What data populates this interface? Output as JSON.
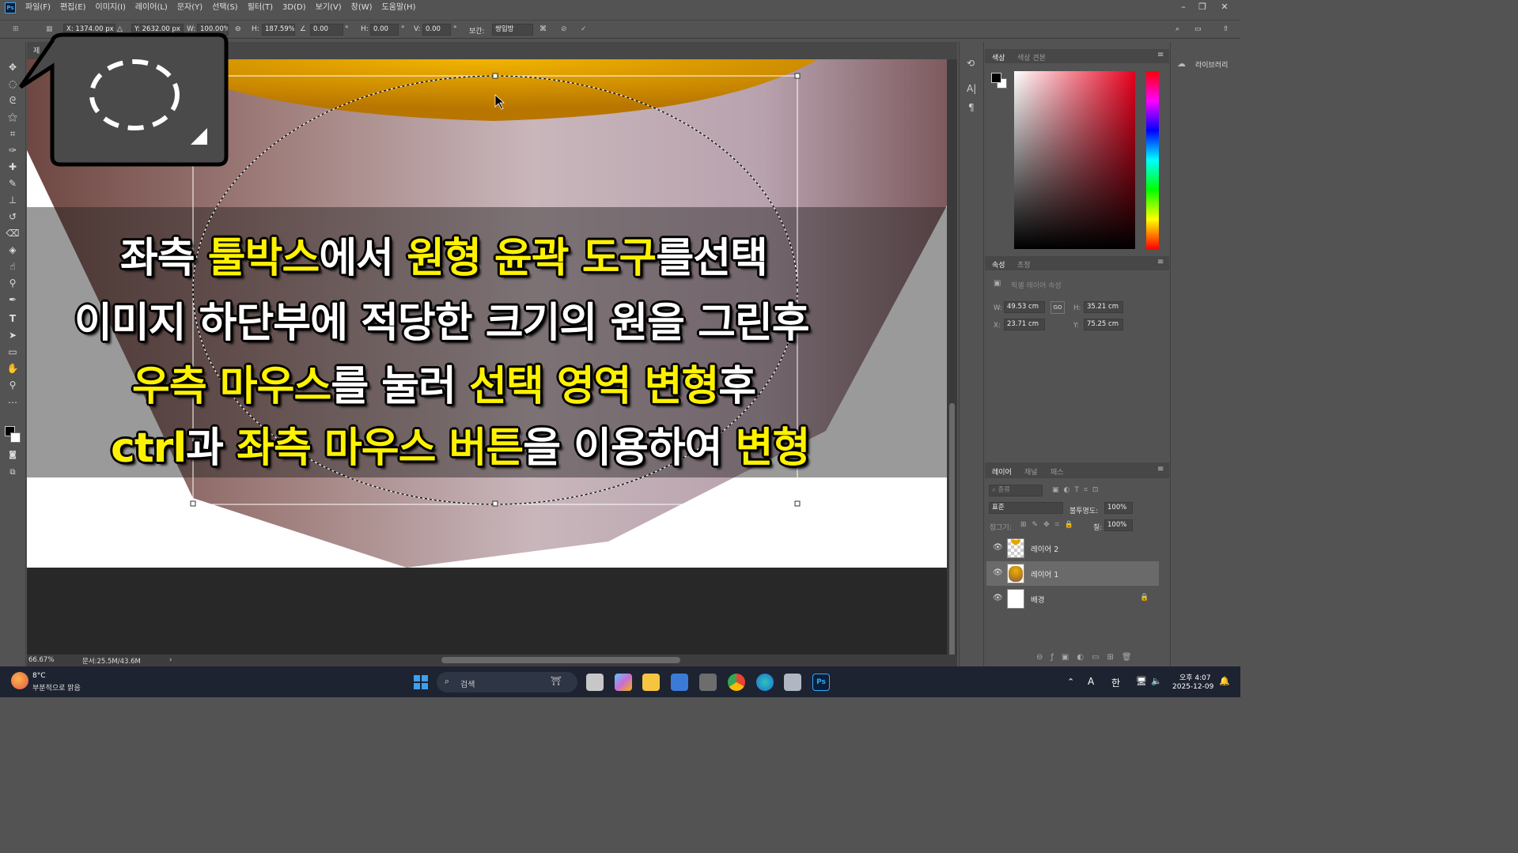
{
  "app": {
    "logo": "Ps",
    "menu": [
      "파일(F)",
      "편집(E)",
      "이미지(I)",
      "레이어(L)",
      "문자(Y)",
      "선택(S)",
      "필터(T)",
      "3D(D)",
      "보기(V)",
      "창(W)",
      "도움말(H)"
    ]
  },
  "options": {
    "x": "X: 1374.00 px",
    "y": "Y: 2632.00 px",
    "w_label": "W:",
    "w": "100.00%",
    "h_label": "H:",
    "h": "187.59%",
    "angle": "0.00",
    "hskew_label": "H:",
    "hskew": "0.00",
    "vskew_label": "V:",
    "vskew": "0.00",
    "interp_label": "보간:",
    "interp": "쌍입방"
  },
  "doc": {
    "tab": "제",
    "zoom": "66.67%",
    "docsize": "문서:25.5M/43.6M"
  },
  "caption": {
    "line1": [
      {
        "t": "좌측 ",
        "c": "w"
      },
      {
        "t": "툴박스",
        "c": "y"
      },
      {
        "t": "에서 ",
        "c": "w"
      },
      {
        "t": "원형 윤곽 도구",
        "c": "y"
      },
      {
        "t": "를선택",
        "c": "w"
      }
    ],
    "line2": [
      {
        "t": "이미지 하단부에 적당한 크기의 원을 그린후",
        "c": "w"
      }
    ],
    "line3": [
      {
        "t": "우측 마우스",
        "c": "y"
      },
      {
        "t": "를 눌러 ",
        "c": "w"
      },
      {
        "t": "선택 영역 변형",
        "c": "y"
      },
      {
        "t": "후",
        "c": "w"
      }
    ],
    "line4": [
      {
        "t": "ctrl",
        "c": "y"
      },
      {
        "t": "과 ",
        "c": "w"
      },
      {
        "t": "좌측 마우스 버튼",
        "c": "y"
      },
      {
        "t": "을 이용하여 ",
        "c": "w"
      },
      {
        "t": "변형",
        "c": "y"
      }
    ]
  },
  "color_panel": {
    "tab_color": "색상",
    "tab_swatches": "색상 견본"
  },
  "libraries": {
    "label": "라이브러리"
  },
  "properties": {
    "tab_props": "속성",
    "tab_adjust": "조정",
    "kind": "픽셀 레이어 속성",
    "w": "49.53 cm",
    "h": "35.21 cm",
    "x": "23.71 cm",
    "y": "75.25 cm",
    "w_label": "W:",
    "h_label": "H:",
    "x_label": "X:",
    "y_label": "Y:",
    "link": "GO"
  },
  "layers_panel": {
    "tab_layers": "레이어",
    "tab_channels": "채널",
    "tab_paths": "패스",
    "filter": "종류",
    "blend": "표준",
    "opacity_label": "불투명도:",
    "opacity": "100%",
    "lock_label": "잠그기:",
    "fill_label": "칠:",
    "fill": "100%",
    "layers": [
      {
        "name": "레이어 2",
        "thumb": "checker"
      },
      {
        "name": "레이어 1",
        "thumb": "cup"
      },
      {
        "name": "배경",
        "thumb": "white"
      }
    ]
  },
  "taskbar": {
    "weather_temp": "8°C",
    "weather_desc": "부분적으로 맑음",
    "search": "검색",
    "time": "오후 4:07",
    "date": "2025-12-09",
    "ime_a": "A",
    "ime_han": "한"
  }
}
